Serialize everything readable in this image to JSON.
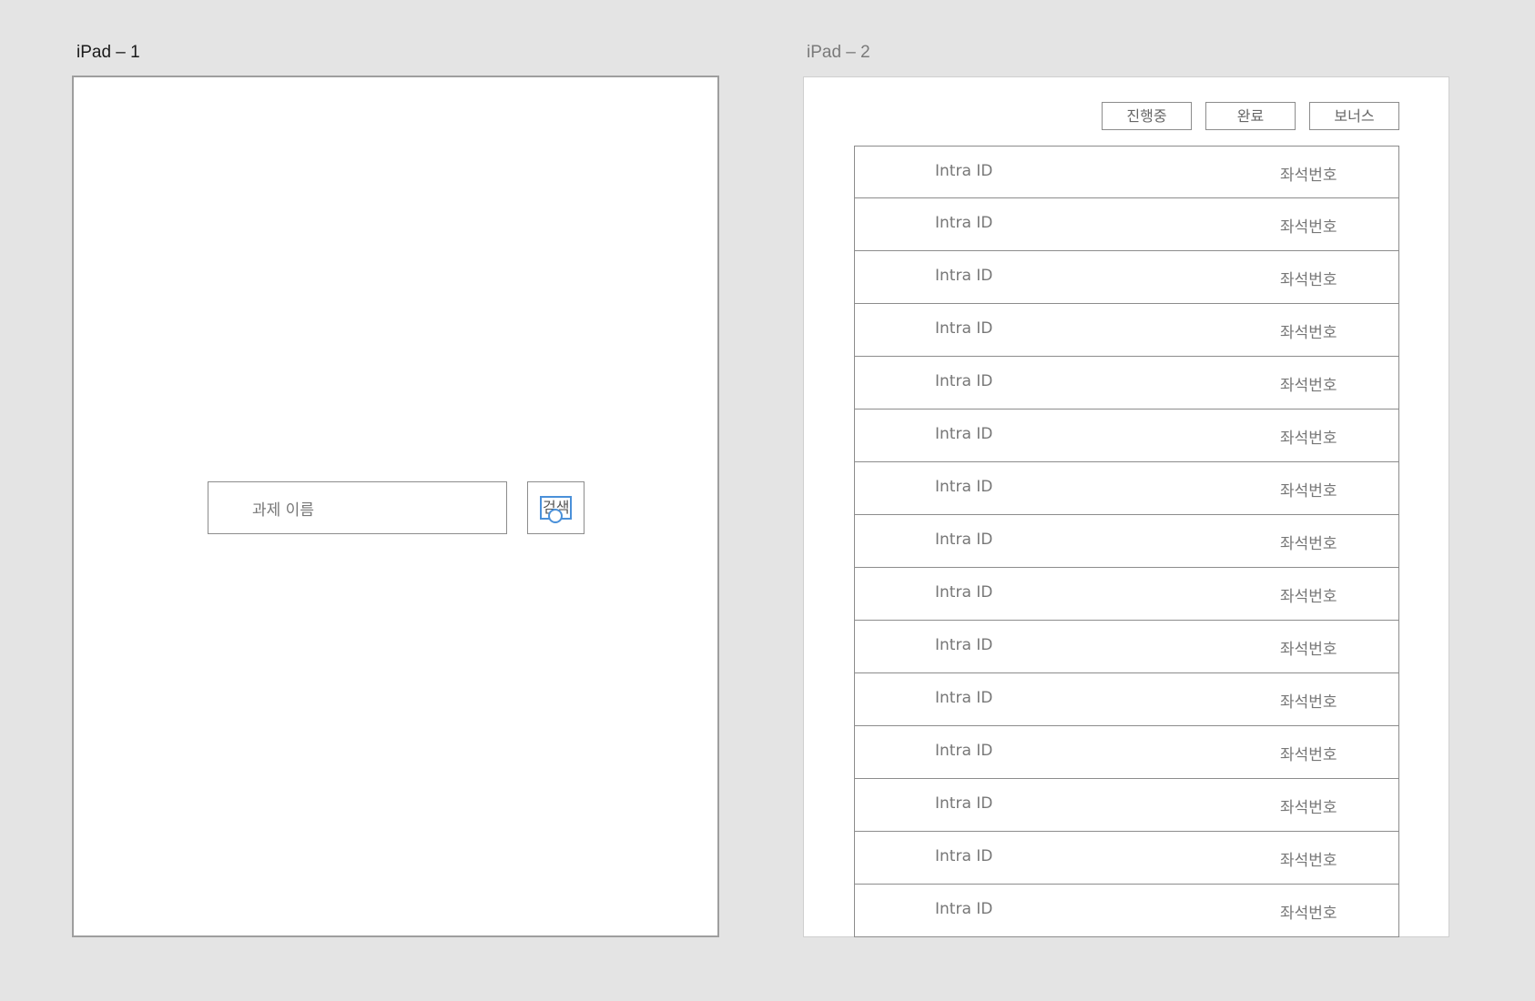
{
  "artboards": {
    "first_title": "iPad – 1",
    "second_title": "iPad – 2"
  },
  "search": {
    "placeholder": "과제 이름",
    "button_label": "검색"
  },
  "filters": {
    "ongoing": "진행중",
    "done": "완료",
    "bonus": "보너스"
  },
  "list": {
    "rows": [
      {
        "intra_id": "Intra ID",
        "seat": "좌석번호"
      },
      {
        "intra_id": "Intra ID",
        "seat": "좌석번호"
      },
      {
        "intra_id": "Intra ID",
        "seat": "좌석번호"
      },
      {
        "intra_id": "Intra ID",
        "seat": "좌석번호"
      },
      {
        "intra_id": "Intra ID",
        "seat": "좌석번호"
      },
      {
        "intra_id": "Intra ID",
        "seat": "좌석번호"
      },
      {
        "intra_id": "Intra ID",
        "seat": "좌석번호"
      },
      {
        "intra_id": "Intra ID",
        "seat": "좌석번호"
      },
      {
        "intra_id": "Intra ID",
        "seat": "좌석번호"
      },
      {
        "intra_id": "Intra ID",
        "seat": "좌석번호"
      },
      {
        "intra_id": "Intra ID",
        "seat": "좌석번호"
      },
      {
        "intra_id": "Intra ID",
        "seat": "좌석번호"
      },
      {
        "intra_id": "Intra ID",
        "seat": "좌석번호"
      },
      {
        "intra_id": "Intra ID",
        "seat": "좌석번호"
      },
      {
        "intra_id": "Intra ID",
        "seat": "좌석번호"
      }
    ]
  }
}
